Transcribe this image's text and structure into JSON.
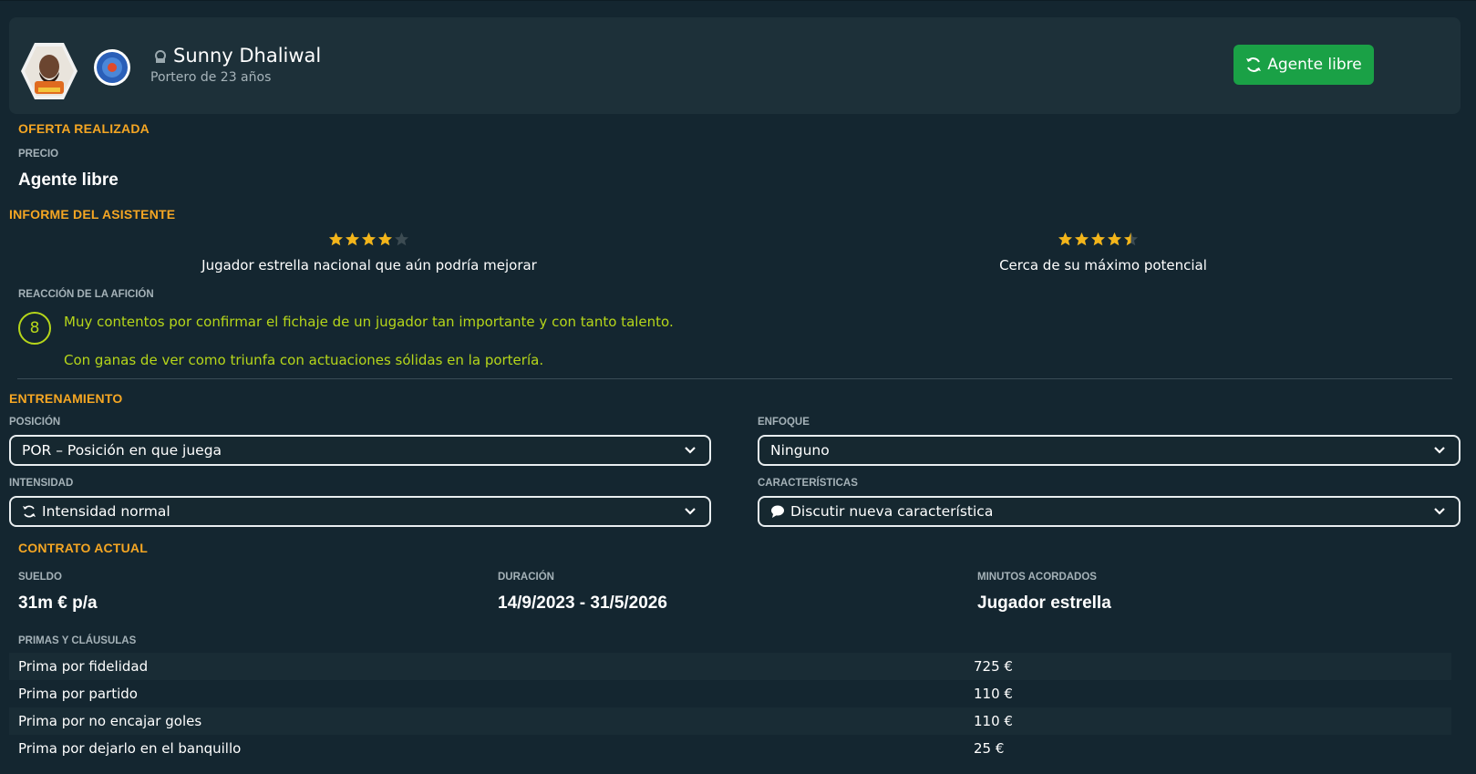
{
  "player": {
    "name": "Sunny Dhaliwal",
    "subtitle": "Portero de 23 años",
    "status_button": "Agente libre"
  },
  "offer": {
    "title": "OFERTA REALIZADA",
    "price_label": "PRECIO",
    "price_value": "Agente libre"
  },
  "assistant": {
    "title": "INFORME DEL ASISTENTE",
    "current": {
      "rating": 4,
      "max": 5,
      "text": "Jugador estrella nacional que aún podría mejorar"
    },
    "potential": {
      "rating": 4.5,
      "max": 5,
      "text": "Cerca de su máximo potencial"
    }
  },
  "fans": {
    "label": "REACCIÓN DE LA AFICIÓN",
    "score": "8",
    "line1": "Muy contentos por confirmar el fichaje de un jugador tan importante y con tanto talento.",
    "line2": "Con ganas de ver como triunfa con actuaciones sólidas en la portería."
  },
  "training": {
    "title": "ENTRENAMIENTO",
    "position_label": "POSICIÓN",
    "position_value": "POR – Posición en que juega",
    "focus_label": "ENFOQUE",
    "focus_value": "Ninguno",
    "intensity_label": "INTENSIDAD",
    "intensity_value": "Intensidad normal",
    "traits_label": "CARACTERÍSTICAS",
    "traits_value": "Discutir nueva característica"
  },
  "contract": {
    "title": "CONTRATO ACTUAL",
    "wage_label": "SUELDO",
    "wage_value": "31m € p/a",
    "duration_label": "DURACIÓN",
    "duration_value": "14/9/2023 - 31/5/2026",
    "minutes_label": "MINUTOS ACORDADOS",
    "minutes_value": "Jugador estrella",
    "bonuses_label": "PRIMAS Y CLÁUSULAS",
    "bonuses": [
      {
        "name": "Prima por fidelidad",
        "value": "725 €"
      },
      {
        "name": "Prima por partido",
        "value": "110 €"
      },
      {
        "name": "Prima por no encajar goles",
        "value": "110 €"
      },
      {
        "name": "Prima por dejarlo en el banquillo",
        "value": "25 €"
      }
    ]
  },
  "colors": {
    "accent": "#f5a623",
    "button_green": "#1aa146",
    "fan_green": "#b6d61a",
    "star": "#f3b51a"
  }
}
